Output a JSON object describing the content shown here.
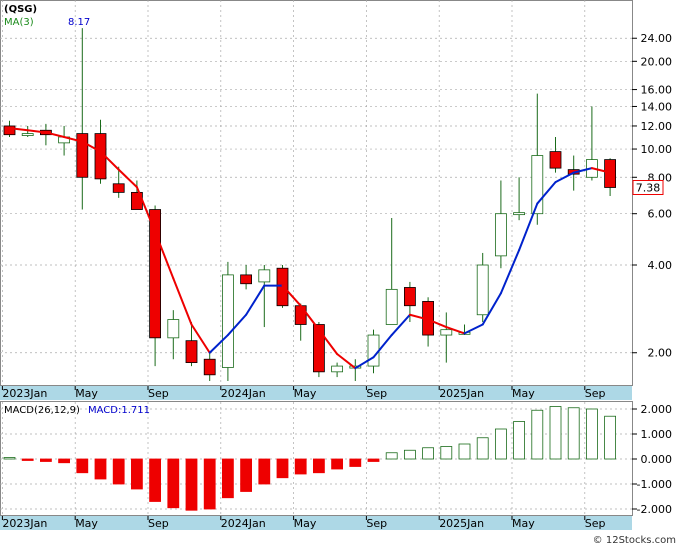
{
  "ticker": "(QSG)",
  "attribution": "© 12Stocks.com",
  "colors": {
    "up_body": "#ffffff",
    "up_border": "#1a6b1a",
    "down_fill": "#ee0000",
    "wick": "#1a6b1a",
    "ma_up": "#0022cc",
    "ma_down": "#ee0000",
    "axis_band": "#add8e6",
    "grid": "#aaaaaa",
    "price_tag": "#ee0000",
    "macd_label": "#0000cc",
    "ma_label": "#1a8a1a"
  },
  "chart_data": [
    {
      "type": "candlestick",
      "title": "(QSG)",
      "legend": {
        "ma_label": "MA(3)",
        "ma_value": "8.17"
      },
      "y_scale": "log",
      "ylim": [
        1.55,
        30
      ],
      "y_ticks": [
        2.0,
        4.0,
        6.0,
        8.0,
        10.0,
        12.0,
        14.0,
        16.0,
        20.0,
        24.0
      ],
      "y_tick_labels": [
        "2.00",
        "4.00",
        "6.00",
        "8.00",
        "10.00",
        "12.00",
        "14.00",
        "16.00",
        "20.00",
        "24.00"
      ],
      "last_price": "7.38",
      "x_tick_labels": [
        "2023Jan",
        "May",
        "Sep",
        "2024Jan",
        "May",
        "Sep",
        "2025Jan",
        "May",
        "Sep"
      ],
      "x_tick_month_index": [
        0,
        4,
        8,
        12,
        16,
        20,
        24,
        28,
        32
      ],
      "candles": [
        {
          "month": "2023-01",
          "open": 12.0,
          "high": 12.5,
          "low": 11.0,
          "close": 11.2
        },
        {
          "month": "2023-02",
          "open": 11.3,
          "high": 12.0,
          "low": 11.0,
          "close": 11.3
        },
        {
          "month": "2023-03",
          "open": 11.6,
          "high": 12.2,
          "low": 10.3,
          "close": 11.2
        },
        {
          "month": "2023-04",
          "open": 10.5,
          "high": 12.0,
          "low": 9.5,
          "close": 11.0
        },
        {
          "month": "2023-05",
          "open": 11.3,
          "high": 26.0,
          "low": 6.2,
          "close": 8.0
        },
        {
          "month": "2023-06",
          "open": 11.3,
          "high": 12.6,
          "low": 7.6,
          "close": 7.9
        },
        {
          "month": "2023-07",
          "open": 7.6,
          "high": 8.7,
          "low": 6.8,
          "close": 7.1
        },
        {
          "month": "2023-08",
          "open": 7.1,
          "high": 7.8,
          "low": 6.2,
          "close": 6.2
        },
        {
          "month": "2023-09",
          "open": 6.2,
          "high": 6.4,
          "low": 1.8,
          "close": 2.25
        },
        {
          "month": "2023-10",
          "open": 2.25,
          "high": 2.8,
          "low": 1.9,
          "close": 2.6
        },
        {
          "month": "2023-11",
          "open": 2.2,
          "high": 2.55,
          "low": 1.8,
          "close": 1.85
        },
        {
          "month": "2023-12",
          "open": 1.9,
          "high": 2.0,
          "low": 1.6,
          "close": 1.68
        },
        {
          "month": "2024-01",
          "open": 1.78,
          "high": 4.1,
          "low": 1.6,
          "close": 3.7
        },
        {
          "month": "2024-02",
          "open": 3.7,
          "high": 4.0,
          "low": 3.3,
          "close": 3.45
        },
        {
          "month": "2024-03",
          "open": 3.5,
          "high": 4.0,
          "low": 2.45,
          "close": 3.85
        },
        {
          "month": "2024-04",
          "open": 3.9,
          "high": 4.0,
          "low": 2.85,
          "close": 2.9
        },
        {
          "month": "2024-05",
          "open": 2.9,
          "high": 2.95,
          "low": 2.2,
          "close": 2.5
        },
        {
          "month": "2024-06",
          "open": 2.5,
          "high": 2.55,
          "low": 1.65,
          "close": 1.72
        },
        {
          "month": "2024-07",
          "open": 1.72,
          "high": 1.85,
          "low": 1.65,
          "close": 1.8
        },
        {
          "month": "2024-08",
          "open": 1.8,
          "high": 1.9,
          "low": 1.6,
          "close": 1.8
        },
        {
          "month": "2024-09",
          "open": 1.8,
          "high": 2.4,
          "low": 1.7,
          "close": 2.3
        },
        {
          "month": "2024-10",
          "open": 2.5,
          "high": 5.8,
          "low": 2.5,
          "close": 3.3
        },
        {
          "month": "2024-11",
          "open": 3.35,
          "high": 3.5,
          "low": 2.55,
          "close": 2.9
        },
        {
          "month": "2024-12",
          "open": 3.0,
          "high": 3.1,
          "low": 2.1,
          "close": 2.3
        },
        {
          "month": "2025-01",
          "open": 2.3,
          "high": 2.75,
          "low": 1.85,
          "close": 2.4
        },
        {
          "month": "2025-02",
          "open": 2.35,
          "high": 2.5,
          "low": 2.3,
          "close": 2.35
        },
        {
          "month": "2025-03",
          "open": 2.7,
          "high": 4.4,
          "low": 2.55,
          "close": 4.0
        },
        {
          "month": "2025-04",
          "open": 4.3,
          "high": 7.8,
          "low": 3.9,
          "close": 6.0
        },
        {
          "month": "2025-05",
          "open": 6.0,
          "high": 8.0,
          "low": 5.7,
          "close": 6.05
        },
        {
          "month": "2025-06",
          "open": 6.0,
          "high": 15.5,
          "low": 5.5,
          "close": 9.5
        },
        {
          "month": "2025-07",
          "open": 9.8,
          "high": 11.0,
          "low": 8.3,
          "close": 8.6
        },
        {
          "month": "2025-08",
          "open": 8.5,
          "high": 9.5,
          "low": 7.2,
          "close": 8.2
        },
        {
          "month": "2025-09",
          "open": 8.0,
          "high": 14.0,
          "low": 7.8,
          "close": 9.2
        },
        {
          "month": "2025-10",
          "open": 9.2,
          "high": 9.3,
          "low": 6.9,
          "close": 7.38
        }
      ],
      "ma_values": [
        11.8,
        11.6,
        11.4,
        11.0,
        10.6,
        9.8,
        8.5,
        7.4,
        5.2,
        3.6,
        2.5,
        2.0,
        2.3,
        2.7,
        3.4,
        3.4,
        2.9,
        2.4,
        1.98,
        1.77,
        1.93,
        2.3,
        2.7,
        2.6,
        2.45,
        2.33,
        2.5,
        3.2,
        4.5,
        6.5,
        7.7,
        8.3,
        8.6,
        8.3
      ]
    },
    {
      "type": "bar",
      "title": "MACD(26,12,9)",
      "value_label": "MACD:1.711",
      "ylim": [
        -2.2,
        2.2
      ],
      "y_ticks": [
        -2.0,
        -1.0,
        0.0,
        1.0,
        2.0
      ],
      "y_tick_labels": [
        "-2.000",
        "-1.000",
        "0.000",
        "1.000",
        "2.000"
      ],
      "x_tick_labels": [
        "2023Jan",
        "May",
        "Sep",
        "2024Jan",
        "May",
        "Sep",
        "2025Jan",
        "May",
        "Sep"
      ],
      "values": [
        0.0,
        -0.05,
        -0.1,
        -0.15,
        -0.55,
        -0.8,
        -1.0,
        -1.2,
        -1.7,
        -1.95,
        -2.05,
        -2.0,
        -1.55,
        -1.3,
        -1.0,
        -0.75,
        -0.6,
        -0.55,
        -0.4,
        -0.3,
        -0.1,
        0.25,
        0.35,
        0.45,
        0.5,
        0.6,
        0.85,
        1.2,
        1.5,
        1.95,
        2.1,
        2.05,
        2.0,
        1.711
      ]
    }
  ]
}
